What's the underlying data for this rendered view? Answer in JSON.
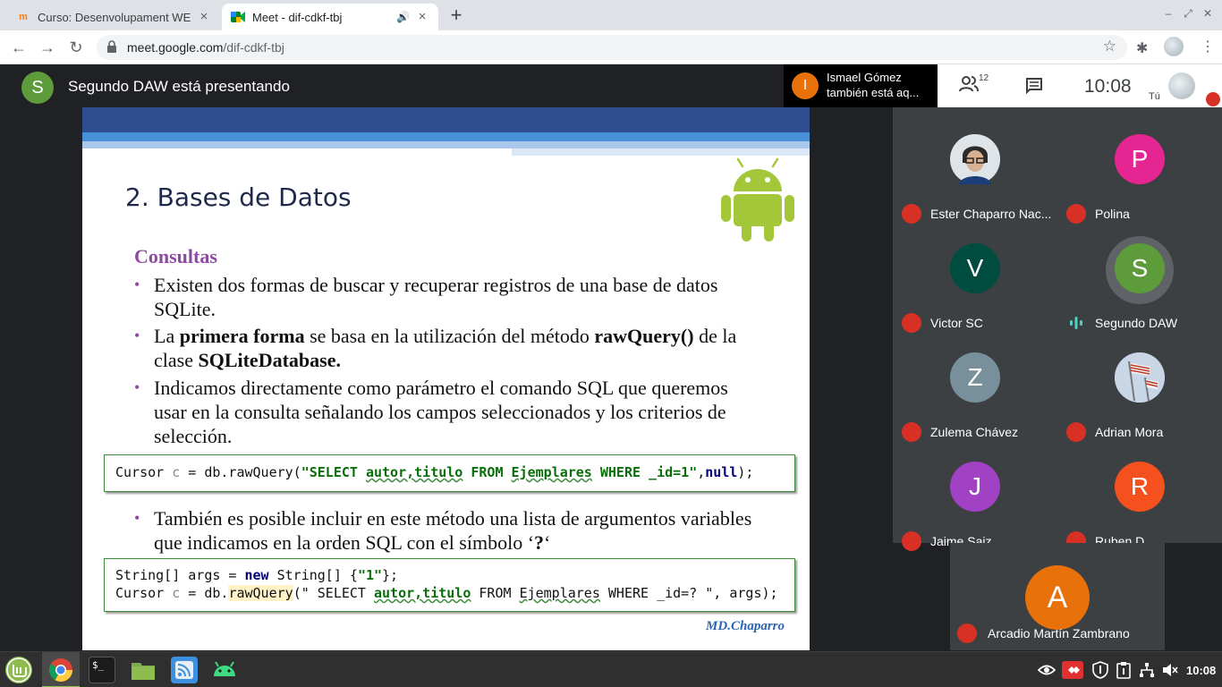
{
  "browser": {
    "tabs": [
      {
        "title": "Curso: Desenvolupament WEB",
        "favicon": "moodle-icon",
        "active": false
      },
      {
        "title": "Meet - dif-cdkf-tbj",
        "favicon": "google-meet-icon",
        "active": true
      }
    ],
    "url_host": "meet.google.com",
    "url_path": "/dif-cdkf-tbj"
  },
  "meet": {
    "presenter_initial": "S",
    "presenting_text": "Segundo DAW está presentando",
    "join_notice": {
      "initial": "I",
      "line1": "Ismael Gómez",
      "line2": "también está aq..."
    },
    "people_count": "12",
    "time": "10:08",
    "self_label": "Tú"
  },
  "slide": {
    "title": "2. Bases de Datos",
    "subtitle": "Consultas",
    "bullet1": "Existen dos formas de buscar y recuperar registros de una base de datos SQLite.",
    "bullet2": {
      "pre": "La ",
      "b1": "primera forma",
      "mid": " se basa en la utilización del método ",
      "b2": "rawQuery()",
      "mid2": " de la clase ",
      "b3": "SQLiteDatabase."
    },
    "bullet3": "Indicamos directamente como parámetro el comando SQL que queremos usar en la consulta señalando los campos seleccionados y los criterios de selección.",
    "code1": {
      "a": "Cursor ",
      "b": "c",
      "c": " = db.rawQuery(",
      "d": "\"SELECT ",
      "e": "autor,titulo",
      "f": " FROM ",
      "g": "Ejemplares",
      "h": " WHERE _id=1\"",
      "i": ",",
      "j": "null",
      "k": ");"
    },
    "bullet4": {
      "pre": "También es posible incluir en este método una lista de argumentos variables que indicamos en la orden SQL con el símbolo ‘",
      "b": "?",
      "post": "‘"
    },
    "code2_line1": {
      "a": "String[] args = ",
      "b": "new",
      "c": " String[] {",
      "d": "\"1\"",
      "e": "};"
    },
    "code2_line2": {
      "a": "Cursor ",
      "b": "c",
      "c": " = db.",
      "d": "rawQuery",
      "e": "(\" SELECT ",
      "f": "autor,titulo",
      "g": " FROM ",
      "h": "Ejemplares",
      "i": " WHERE _id=? \", args);"
    },
    "signature": "MD.Chaparro"
  },
  "participants": [
    {
      "name": "Ester Chaparro Nac...",
      "initial": "",
      "color": "#6b7a86",
      "muted": true,
      "photo": true
    },
    {
      "name": "Polina",
      "initial": "P",
      "color": "#e52592",
      "muted": true
    },
    {
      "name": "Victor SC",
      "initial": "V",
      "color": "#004d40",
      "muted": true
    },
    {
      "name": "Segundo DAW",
      "initial": "S",
      "color": "#5e9b3a",
      "muted": false,
      "speaking": true
    },
    {
      "name": "Zulema Chávez",
      "initial": "Z",
      "color": "#78909c",
      "muted": true
    },
    {
      "name": "Adrian Mora",
      "initial": "",
      "color": "#b0c4de",
      "muted": true,
      "photo": true
    },
    {
      "name": "Jaime Saiz",
      "initial": "J",
      "color": "#a142c4",
      "muted": true
    },
    {
      "name": "Ruben D",
      "initial": "R",
      "color": "#f4511e",
      "muted": true
    }
  ],
  "featured": {
    "name": "Arcadio Martín Zambrano",
    "initial": "A",
    "color": "#e8710a"
  },
  "taskbar": {
    "time": "10:08",
    "apps": [
      "mint-menu-icon",
      "chrome-icon",
      "terminal-icon",
      "files-icon",
      "rss-icon",
      "android-icon"
    ],
    "terminal_glyph": "$_"
  }
}
